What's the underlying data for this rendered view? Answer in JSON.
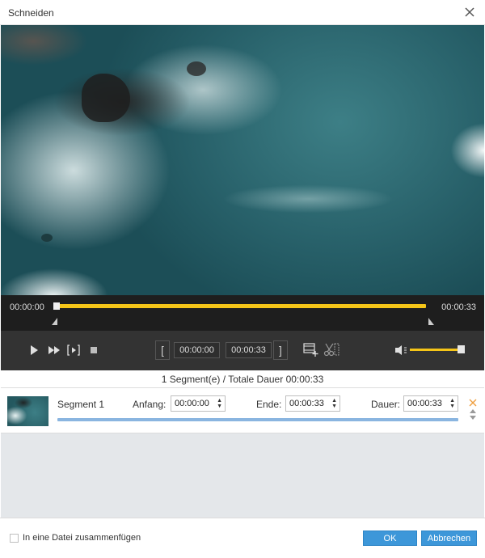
{
  "window": {
    "title": "Schneiden"
  },
  "timeline": {
    "start_time": "00:00:00",
    "end_time": "00:00:33"
  },
  "controls": {
    "start_field": "00:00:00",
    "end_field": "00:00:33",
    "bracket_open": "[",
    "bracket_close": "]"
  },
  "summary": {
    "text": "1 Segment(e) / Totale Dauer 00:00:33"
  },
  "segment": {
    "name": "Segment 1",
    "start_label": "Anfang:",
    "start_value": "00:00:00",
    "end_label": "Ende:",
    "end_value": "00:00:33",
    "duration_label": "Dauer:",
    "duration_value": "00:00:33"
  },
  "footer": {
    "merge_label": "In eine Datei zusammenfügen",
    "ok_label": "OK",
    "cancel_label": "Abbrechen"
  },
  "colors": {
    "accent": "#f5c518",
    "button": "#3d97d9",
    "progress": "#8ab5e0"
  }
}
